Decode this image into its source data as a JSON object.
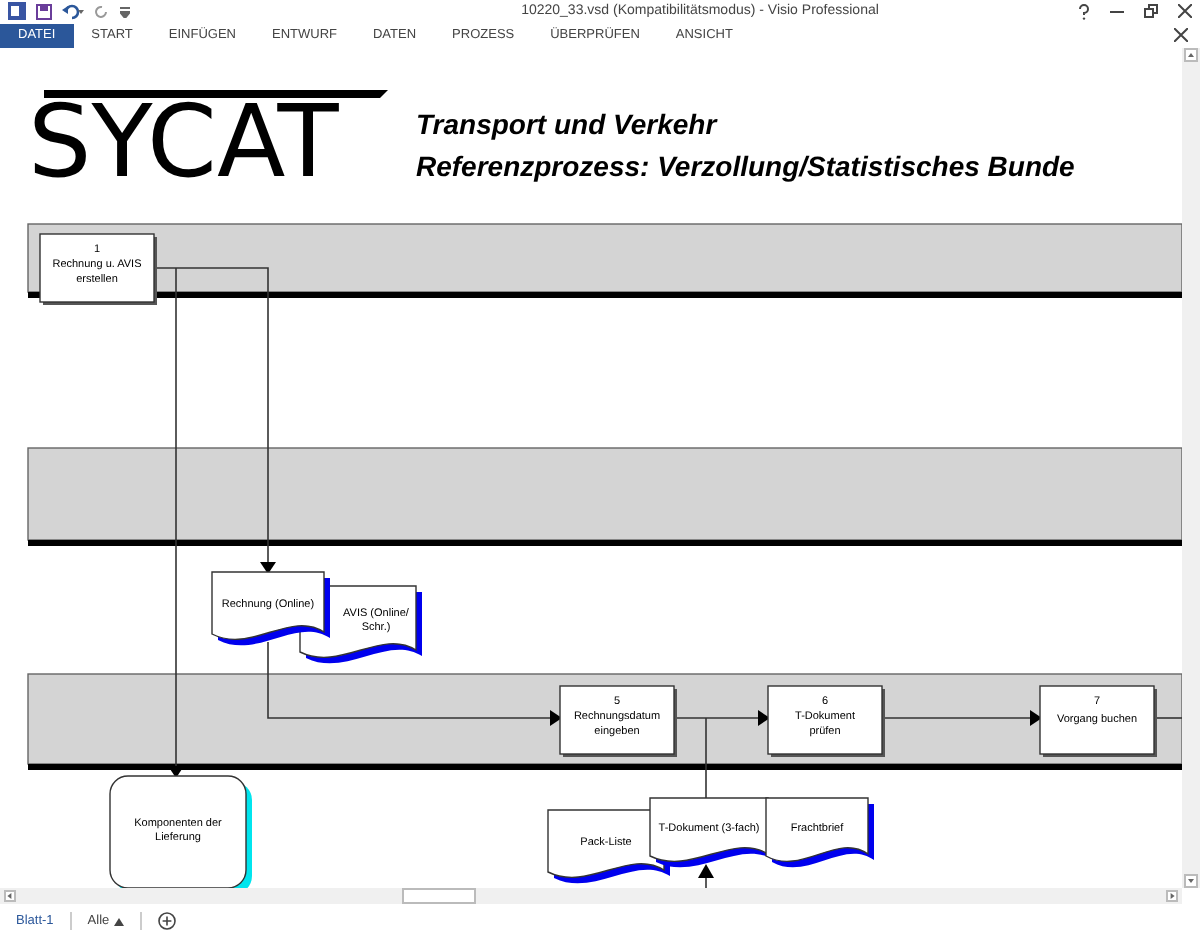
{
  "window": {
    "title": "10220_33.vsd  (Kompatibilitätsmodus) - Visio Professional"
  },
  "ribbon_tabs": [
    {
      "label": "DATEI",
      "selected": true
    },
    {
      "label": "START",
      "selected": false
    },
    {
      "label": "EINFÜGEN",
      "selected": false
    },
    {
      "label": "ENTWURF",
      "selected": false
    },
    {
      "label": "DATEN",
      "selected": false
    },
    {
      "label": "PROZESS",
      "selected": false
    },
    {
      "label": "ÜBERPRÜFEN",
      "selected": false
    },
    {
      "label": "ANSICHT",
      "selected": false
    }
  ],
  "header": {
    "logo": "SYCAT",
    "title_lines": [
      "Transport und Verkehr",
      "Referenzprozess: Verzollung/Statistisches Bunde"
    ]
  },
  "diagram": {
    "processes": [
      {
        "number": "1",
        "lines": [
          "Rechnung u. AVIS",
          "erstellen"
        ]
      },
      {
        "number": "5",
        "lines": [
          "Rechnungsdatum",
          "eingeben"
        ]
      },
      {
        "number": "6",
        "lines": [
          "T-Dokument",
          "prüfen"
        ]
      },
      {
        "number": "7",
        "lines": [
          "Vorgang buchen"
        ]
      }
    ],
    "documents": [
      {
        "lines": [
          "Rechnung (Online)"
        ]
      },
      {
        "lines": [
          "AVIS (Online/",
          "Schr.)"
        ]
      },
      {
        "lines": [
          "Pack-Liste"
        ]
      },
      {
        "lines": [
          "T-Dokument (3-fach)"
        ]
      },
      {
        "lines": [
          "Frachtbrief"
        ]
      }
    ],
    "terminals": [
      {
        "lines": [
          "Komponenten der",
          "Lieferung"
        ]
      }
    ]
  },
  "sheet_tabs": [
    {
      "label": "Blatt-1",
      "selected": true
    }
  ],
  "sheet_filter": "Alle"
}
